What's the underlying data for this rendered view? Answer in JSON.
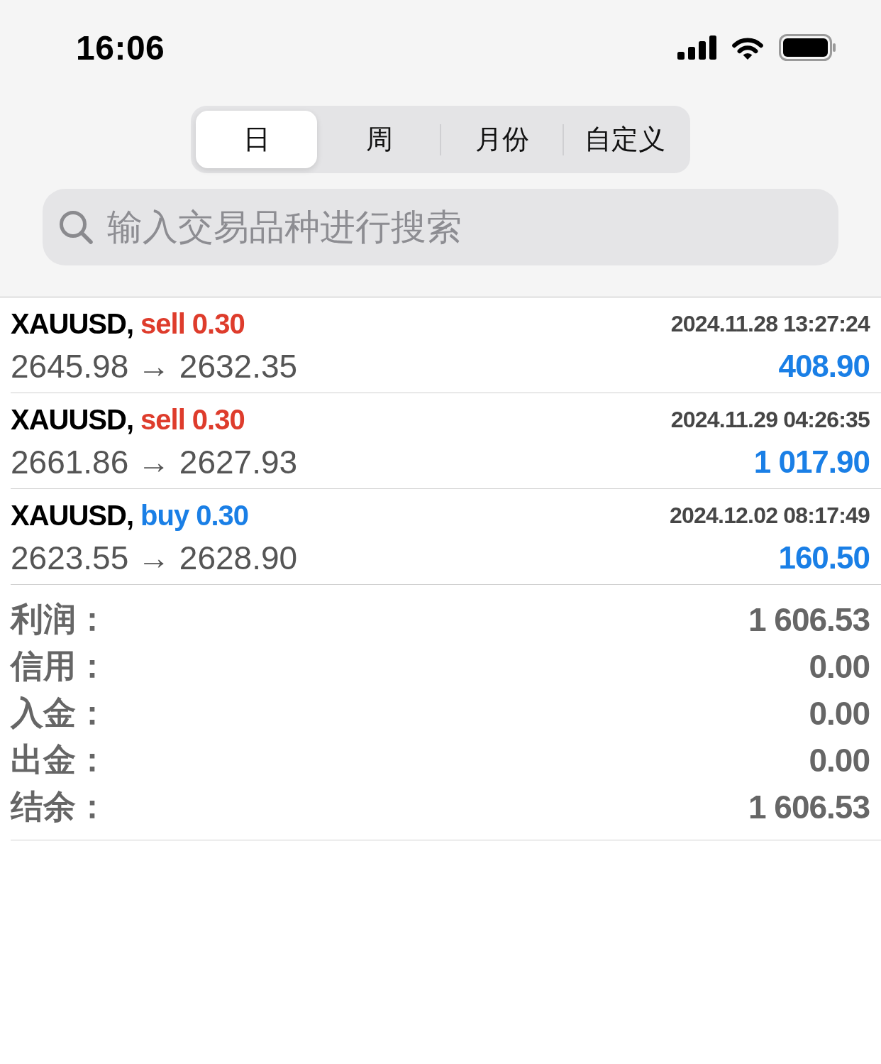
{
  "status_bar": {
    "time": "16:06"
  },
  "tabs": [
    {
      "label": "日",
      "selected": true
    },
    {
      "label": "周",
      "selected": false
    },
    {
      "label": "月份",
      "selected": false
    },
    {
      "label": "自定义",
      "selected": false
    }
  ],
  "search": {
    "placeholder": "输入交易品种进行搜索"
  },
  "trades": [
    {
      "symbol": "XAUUSD,",
      "kind": "sell",
      "order": "sell 0.30",
      "time": "2024.11.28 13:27:24",
      "prices": "2645.98 → 2632.35",
      "profit": "408.90"
    },
    {
      "symbol": "XAUUSD,",
      "kind": "sell",
      "order": "sell 0.30",
      "time": "2024.11.29 04:26:35",
      "prices": "2661.86 → 2627.93",
      "profit": "1 017.90"
    },
    {
      "symbol": "XAUUSD,",
      "kind": "buy",
      "order": "buy 0.30",
      "time": "2024.12.02 08:17:49",
      "prices": "2623.55 → 2628.90",
      "profit": "160.50"
    }
  ],
  "summary": [
    {
      "label": "利润：",
      "value": "1 606.53"
    },
    {
      "label": "信用：",
      "value": "0.00"
    },
    {
      "label": "入金：",
      "value": "0.00"
    },
    {
      "label": "出金：",
      "value": "0.00"
    },
    {
      "label": "结余：",
      "value": "1 606.53"
    }
  ]
}
